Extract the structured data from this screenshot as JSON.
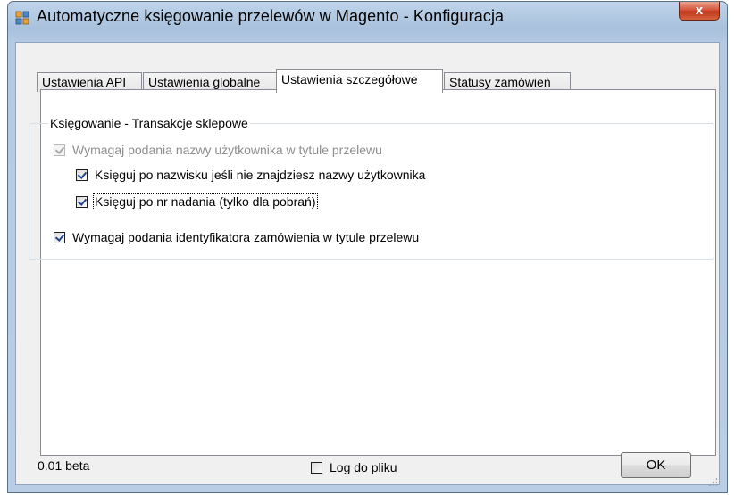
{
  "window": {
    "title": "Automatyczne księgowanie przelewów w Magento - Konfiguracja",
    "close_label": "x"
  },
  "tabs": [
    {
      "label": "Ustawienia API"
    },
    {
      "label": "Ustawienia globalne"
    },
    {
      "label": "Ustawienia szczegółowe"
    },
    {
      "label": "Statusy zamówień"
    }
  ],
  "active_tab": "Ustawienia szczegółowe",
  "group": {
    "title": "Księgowanie - Transakcje sklepowe",
    "options": [
      {
        "label": "Wymagaj podania nazwy użytkownika w tytule przelewu",
        "checked": true,
        "enabled": false
      },
      {
        "label": "Księguj po nazwisku jeśli nie znajdziesz nazwy użytkownika",
        "checked": true,
        "enabled": true
      },
      {
        "label": "Księguj po nr nadania (tylko dla pobrań)",
        "checked": true,
        "enabled": true,
        "focused": true
      },
      {
        "label": "Wymagaj podania identyfikatora zamówienia w tytule przelewu",
        "checked": true,
        "enabled": true
      }
    ]
  },
  "footer": {
    "version": "0.01 beta",
    "log_label": "Log do pliku",
    "log_checked": false,
    "ok_label": "OK"
  },
  "colors": {
    "title_bar": "#b4cae3",
    "close_button": "#c2391d",
    "client_bg": "#f0f0f0",
    "checkmark": "#21448c"
  }
}
